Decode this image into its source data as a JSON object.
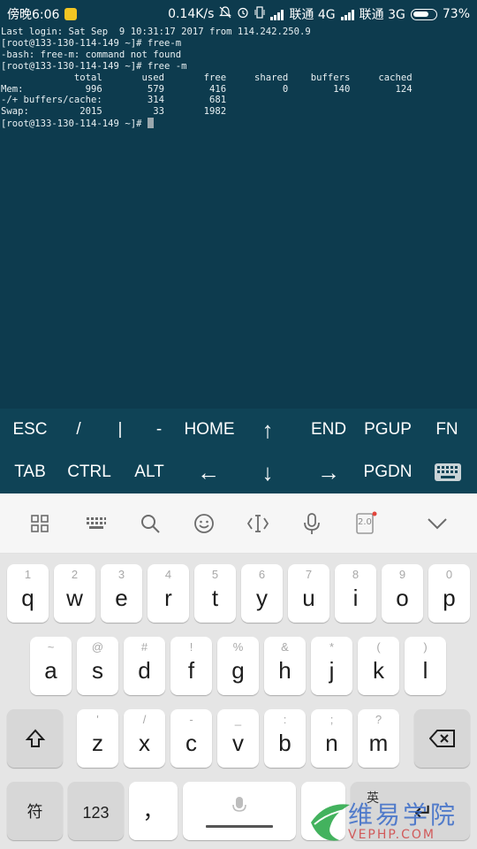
{
  "status_bar": {
    "time": "傍晚6:06",
    "net_speed": "0.14K/s",
    "carrier1": "联通 4G",
    "carrier2": "联通 3G",
    "battery": "73%",
    "battery_level": 0.73,
    "icons": [
      "app-notification-icon",
      "mute-icon",
      "alarm-icon",
      "vibrate-icon",
      "signal-icon",
      "signal-icon",
      "battery-icon"
    ]
  },
  "terminal": {
    "lines": [
      "Last login: Sat Sep  9 10:31:17 2017 from 114.242.250.9",
      "[root@133-130-114-149 ~]# free-m",
      "-bash: free-m: command not found",
      "[root@133-130-114-149 ~]# free -m",
      "             total       used       free     shared    buffers     cached",
      "Mem:           996        579        416          0        140        124",
      "-/+ buffers/cache:        314        681",
      "Swap:         2015         33       1982",
      "[root@133-130-114-149 ~]# "
    ]
  },
  "extra_keys": {
    "row1": [
      "ESC",
      "/",
      "|",
      "-",
      "HOME",
      "↑",
      "END",
      "PGUP",
      "FN"
    ],
    "row2": [
      "TAB",
      "CTRL",
      "ALT",
      "←",
      "↓",
      "→",
      "PGDN",
      "keyboard-icon"
    ]
  },
  "toolbar": {
    "icons": [
      "grid-menu-icon",
      "keypad-icon",
      "search-icon",
      "emoji-icon",
      "text-cursor-icon",
      "microphone-icon",
      "keyboard-version-icon",
      "collapse-chevron-icon"
    ],
    "version_label": "2.0"
  },
  "keyboard": {
    "row1": [
      {
        "hint": "1",
        "key": "q"
      },
      {
        "hint": "2",
        "key": "w"
      },
      {
        "hint": "3",
        "key": "e"
      },
      {
        "hint": "4",
        "key": "r"
      },
      {
        "hint": "5",
        "key": "t"
      },
      {
        "hint": "6",
        "key": "y"
      },
      {
        "hint": "7",
        "key": "u"
      },
      {
        "hint": "8",
        "key": "i"
      },
      {
        "hint": "9",
        "key": "o"
      },
      {
        "hint": "0",
        "key": "p"
      }
    ],
    "row2": [
      {
        "hint": "~",
        "key": "a"
      },
      {
        "hint": "@",
        "key": "s"
      },
      {
        "hint": "#",
        "key": "d"
      },
      {
        "hint": "!",
        "key": "f"
      },
      {
        "hint": "%",
        "key": "g"
      },
      {
        "hint": "&",
        "key": "h"
      },
      {
        "hint": "*",
        "key": "j"
      },
      {
        "hint": "(",
        "key": "k"
      },
      {
        "hint": ")",
        "key": "l"
      }
    ],
    "row3": [
      {
        "hint": "'",
        "key": "z"
      },
      {
        "hint": "/",
        "key": "x"
      },
      {
        "hint": "-",
        "key": "c"
      },
      {
        "hint": "_",
        "key": "v"
      },
      {
        "hint": ":",
        "key": "b"
      },
      {
        "hint": ";",
        "key": "n"
      },
      {
        "hint": "?",
        "key": "m"
      }
    ],
    "symbols_key": "符",
    "numbers_key": "123",
    "comma_key": "，",
    "lang_key": "英",
    "enter_key": "↵"
  },
  "watermark": {
    "text_cn": "维易学院",
    "text_en": "VEPHP.COM"
  }
}
